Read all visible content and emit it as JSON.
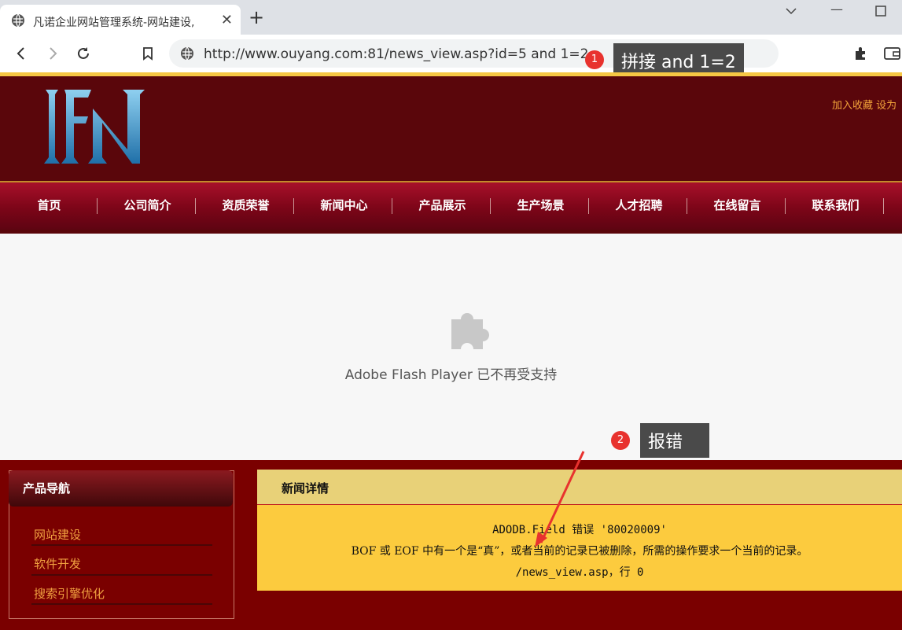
{
  "browser": {
    "tab_title": "凡诺企业网站管理系统-网站建设,",
    "url": "http://www.ouyang.com:81/news_view.asp?id=5 and 1=2"
  },
  "annotations": [
    {
      "number": "1",
      "text": "拼接 and 1=2"
    },
    {
      "number": "2",
      "text": "报错"
    }
  ],
  "header": {
    "links": "加入收藏  设为"
  },
  "nav": {
    "items": [
      "首页",
      "公司简介",
      "资质荣誉",
      "新闻中心",
      "产品展示",
      "生产场景",
      "人才招聘",
      "在线留言",
      "联系我们"
    ]
  },
  "flash": {
    "message": "Adobe Flash Player 已不再受支持"
  },
  "sidebar": {
    "title": "产品导航",
    "items": [
      "网站建设",
      "软件开发",
      "搜索引擎优化"
    ]
  },
  "news": {
    "title": "新闻详情",
    "error_line1": "ADODB.Field 错误 '80020009'",
    "error_line2": "BOF 或 EOF 中有一个是“真”，或者当前的记录已被删除，所需的操作要求一个当前的记录。",
    "error_line3": "/news_view.asp，行 0"
  },
  "colors": {
    "header_bg": "#5a060b",
    "nav_gold": "#c48a2a",
    "news_bg": "#fccb3e",
    "badge_red": "#e8322e"
  }
}
